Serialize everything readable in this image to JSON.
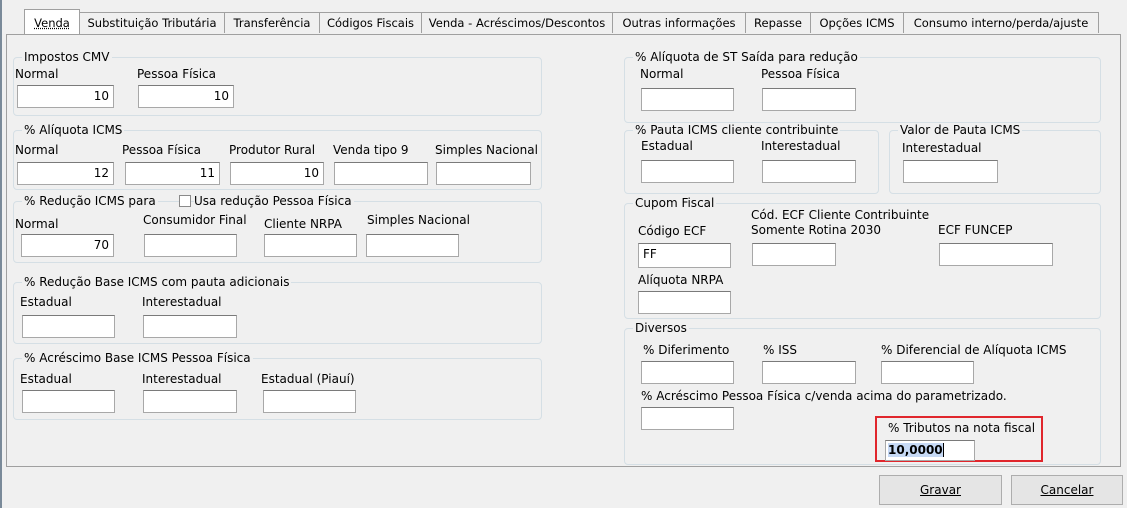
{
  "tabs": [
    "Venda",
    "Substituição Tributária",
    "Transferência",
    "Códigos Fiscais",
    "Venda - Acréscimos/Descontos",
    "Outras informações",
    "Repasse",
    "Opções ICMS",
    "Consumo interno/perda/ajuste"
  ],
  "impostos_cmv": {
    "title": "Impostos CMV",
    "normal_label": "Normal",
    "normal_value": "10",
    "pf_label": "Pessoa Física",
    "pf_value": "10"
  },
  "aliquota_icms": {
    "title": "% Alíquota ICMS",
    "normal_label": "Normal",
    "normal_value": "12",
    "pf_label": "Pessoa Física",
    "pf_value": "11",
    "produtor_label": "Produtor Rural",
    "produtor_value": "10",
    "venda9_label": "Venda tipo 9",
    "venda9_value": "",
    "simples_label": "Simples Nacional",
    "simples_value": ""
  },
  "reducao_icms": {
    "title": "% Redução ICMS para",
    "checkbox_label": "Usa redução Pessoa Física",
    "normal_label": "Normal",
    "normal_value": "70",
    "consumidor_label": "Consumidor Final",
    "consumidor_value": "",
    "nrpa_label": "Cliente NRPA",
    "nrpa_value": "",
    "simples_label": "Simples Nacional",
    "simples_value": ""
  },
  "reducao_base": {
    "title": "% Redução Base ICMS com pauta adicionais",
    "estadual_label": "Estadual",
    "interestadual_label": "Interestadual"
  },
  "acrescimo_base": {
    "title": "% Acréscimo Base ICMS Pessoa Física",
    "estadual_label": "Estadual",
    "interestadual_label": "Interestadual",
    "piaui_label": "Estadual (Piauí)"
  },
  "aliquota_st": {
    "title": "% Alíquota de ST Saída para redução",
    "normal_label": "Normal",
    "pf_label": "Pessoa Física"
  },
  "pauta_icms": {
    "title": "% Pauta ICMS cliente contribuinte",
    "estadual_label": "Estadual",
    "interestadual_label": "Interestadual"
  },
  "valor_pauta": {
    "title": "Valor de Pauta ICMS",
    "interestadual_label": "Interestadual"
  },
  "cupom_fiscal": {
    "title": "Cupom Fiscal",
    "codigo_ecf_label": "Código ECF",
    "codigo_ecf_value": "FF",
    "cod_ecf_cliente_label_1": "Cód. ECF Cliente Contribuinte",
    "cod_ecf_cliente_label_2": "Somente Rotina 2030",
    "funcep_label": "ECF FUNCEP",
    "aliquota_nrpa_label": "Alíquota NRPA"
  },
  "diversos": {
    "title": "Diversos",
    "diferimento_label": "% Diferimento",
    "iss_label": "% ISS",
    "diferencial_label": "% Diferencial de Alíquota ICMS",
    "acrescimo_pf_label": "% Acréscimo Pessoa Física c/venda acima do parametrizado.",
    "tributos_label": "% Tributos na nota fiscal",
    "tributos_value": "10,0000"
  },
  "buttons": {
    "gravar": "Gravar",
    "cancelar": "Cancelar"
  },
  "colors": {
    "highlight": "#e0262c",
    "selection": "#c6d9f5"
  }
}
